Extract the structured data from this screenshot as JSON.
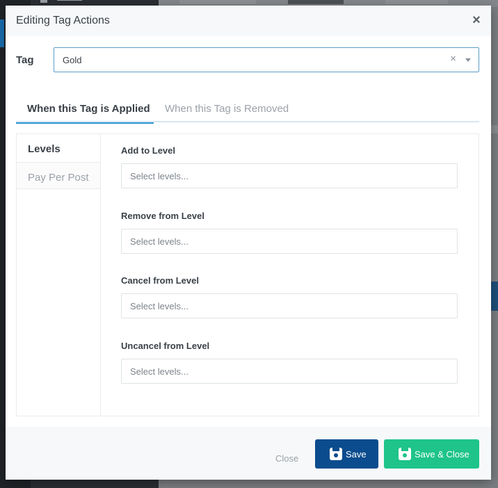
{
  "modal": {
    "title": "Editing Tag Actions",
    "close_icon": "×"
  },
  "tag": {
    "label": "Tag",
    "value": "Gold",
    "clear_icon": "×"
  },
  "tabs": [
    {
      "label": "When this Tag is Applied",
      "active": true
    },
    {
      "label": "When this Tag is Removed",
      "active": false
    }
  ],
  "side": [
    {
      "label": "Levels",
      "active": true
    },
    {
      "label": "Pay Per Post",
      "active": false
    }
  ],
  "fields": [
    {
      "label": "Add to Level",
      "placeholder": "Select levels..."
    },
    {
      "label": "Remove from Level",
      "placeholder": "Select levels..."
    },
    {
      "label": "Cancel from Level",
      "placeholder": "Select levels..."
    },
    {
      "label": "Uncancel from Level",
      "placeholder": "Select levels..."
    }
  ],
  "footer": {
    "close_label": "Close",
    "save_label": "Save",
    "save_close_label": "Save & Close"
  },
  "colors": {
    "primary": "#0a4c8e",
    "success": "#1ec48a",
    "tab_accent": "#2a93d5",
    "select_border": "#5c9ec9"
  },
  "icons": {
    "close": "x-icon",
    "clear": "clear-icon",
    "caret": "chevron-down-icon",
    "save": "floppy-disk-icon"
  }
}
